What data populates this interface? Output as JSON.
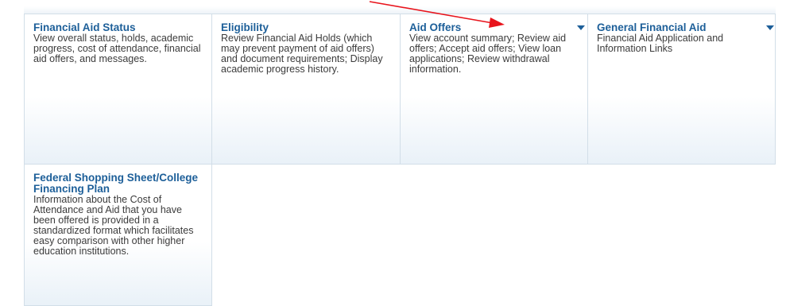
{
  "tiles": [
    {
      "title": "Financial Aid Status",
      "description": "View overall status, holds, academic progress, cost of attendance, financial aid offers, and messages.",
      "has_dropdown": false
    },
    {
      "title": "Eligibility",
      "description": "Review Financial Aid Holds (which may prevent payment of aid offers) and document requirements; Display academic progress history.",
      "has_dropdown": false
    },
    {
      "title": "Aid Offers",
      "description": "View account summary; Review aid offers; Accept aid offers; View loan applications; Review withdrawal information.",
      "has_dropdown": true
    },
    {
      "title": "General Financial Aid",
      "description": "Financial Aid Application and Information Links",
      "has_dropdown": true
    },
    {
      "title": "Federal Shopping Sheet/College Financing Plan",
      "description": "Information about the Cost of Attendance and Aid that you have been offered is provided in a standardized format which facilitates easy comparison with other higher education institutions.",
      "has_dropdown": false
    }
  ],
  "colors": {
    "title": "#1d5f99",
    "text": "#3b3b3b",
    "border": "#d2dee8",
    "annotation_arrow": "#e8141c",
    "dropdown_icon": "#1d5f99"
  },
  "icons": [
    "chevron-down-icon",
    "annotation-arrow-icon"
  ]
}
